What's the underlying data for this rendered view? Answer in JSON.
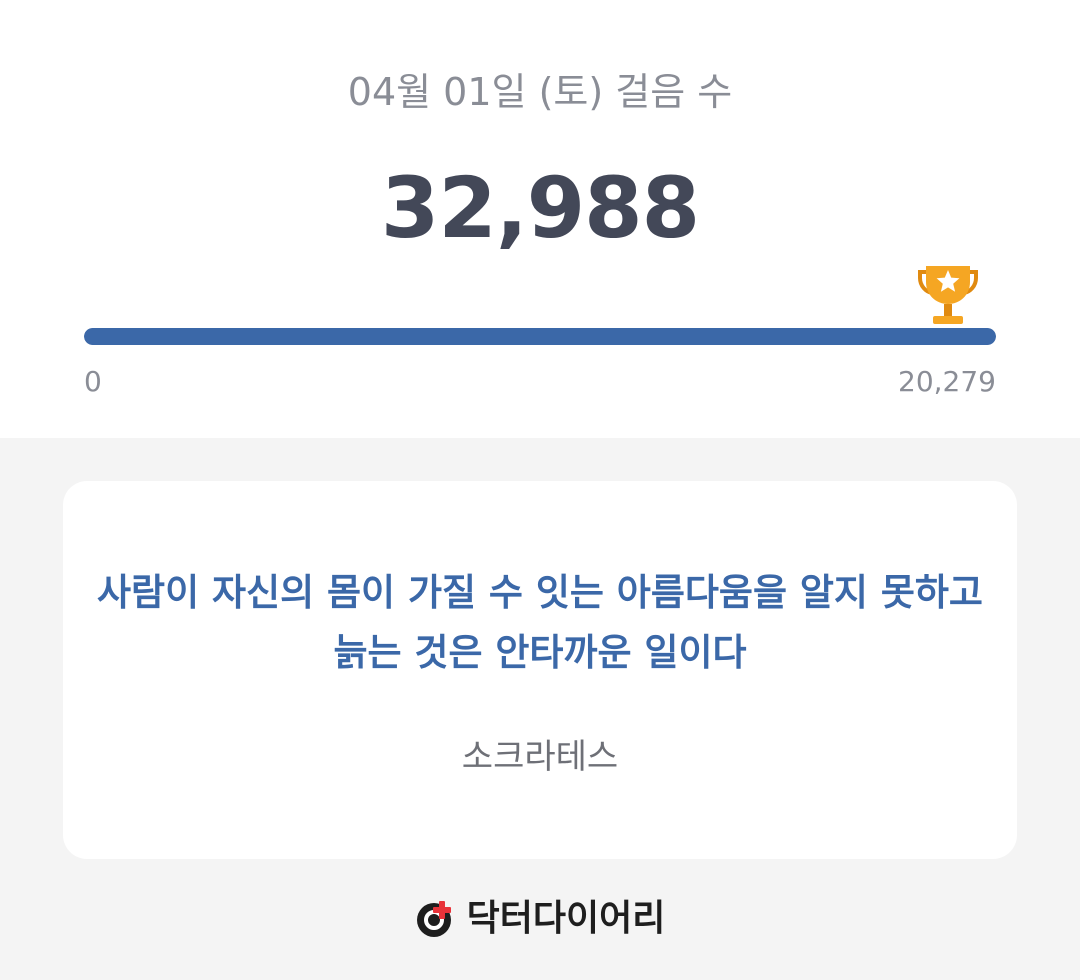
{
  "summary": {
    "title": "04월 01일 (토) 걸음 수",
    "steps": "32,988",
    "goal_progress": 1.0,
    "scale_min": "0",
    "scale_max": "20,279",
    "trophy_icon": "trophy-icon"
  },
  "quote": {
    "text": "사람이 자신의 몸이 가질 수 잇는 아름다움을 알지 못하고 늙는 것은 안타까운 일이다",
    "author": "소크라테스"
  },
  "brand": {
    "name": "닥터다이어리",
    "logo_icon": "doctor-diary-logo-icon"
  },
  "colors": {
    "accent": "#3b68a8",
    "trophy": "#f5a623",
    "logo_cross": "#e8333a"
  }
}
